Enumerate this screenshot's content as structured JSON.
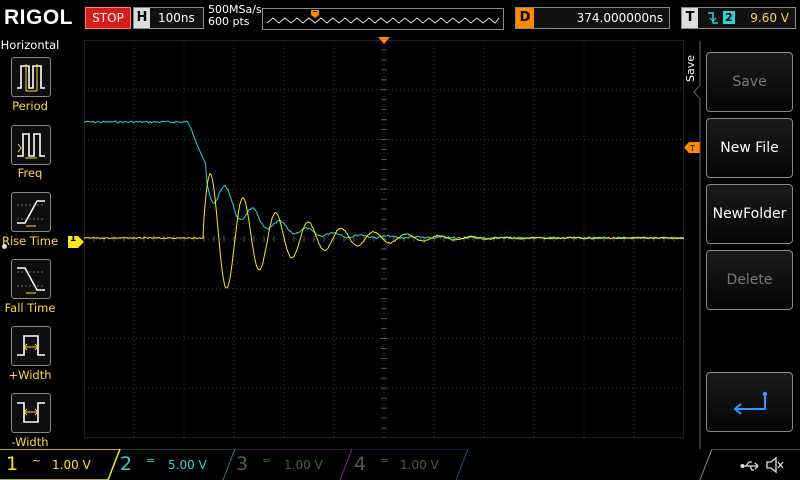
{
  "brand": "RIGOL",
  "run_status": "STOP",
  "horizontal": {
    "tag": "H",
    "timebase": "100ns",
    "sample_rate": "500MSa/s",
    "points": "600 pts"
  },
  "delay": {
    "tag": "D",
    "value": "374.000000ns"
  },
  "trigger": {
    "tag": "T",
    "source": "2",
    "level": "9.60 V"
  },
  "left_menu": {
    "title": "Horizontal",
    "items": [
      {
        "label": "Period"
      },
      {
        "label": "Freq"
      },
      {
        "label": "Rise Time"
      },
      {
        "label": "Fall Time"
      },
      {
        "label": "+Width"
      },
      {
        "label": "-Width"
      }
    ]
  },
  "right_menu": {
    "section": "Save",
    "buttons": [
      {
        "label": "Save",
        "enabled": false
      },
      {
        "label": "New File",
        "enabled": true
      },
      {
        "label": "NewFolder",
        "enabled": true
      },
      {
        "label": "Delete",
        "enabled": false
      }
    ]
  },
  "markers": {
    "ch1": "1"
  },
  "channels": [
    {
      "num": "1",
      "coupling": "~",
      "scale": "1.00 V",
      "active": true,
      "color": "#f5e61e"
    },
    {
      "num": "2",
      "coupling": "=",
      "scale": "5.00 V",
      "active": true,
      "color": "#2fd3d3"
    },
    {
      "num": "3",
      "coupling": "=",
      "scale": "1.00 V",
      "active": false,
      "color": "#d23cd2"
    },
    {
      "num": "4",
      "coupling": "=",
      "scale": "1.00 V",
      "active": false,
      "color": "#3d7fd6"
    }
  ],
  "colors": {
    "ch1": "#f5e61e",
    "ch2": "#2fd3d3",
    "stop": "#d81c1c",
    "delay": "#ff8a00",
    "grid": "#3a3a3a"
  },
  "icons": [
    "usb-icon",
    "speaker-muted-icon",
    "return-arrow-icon"
  ]
}
